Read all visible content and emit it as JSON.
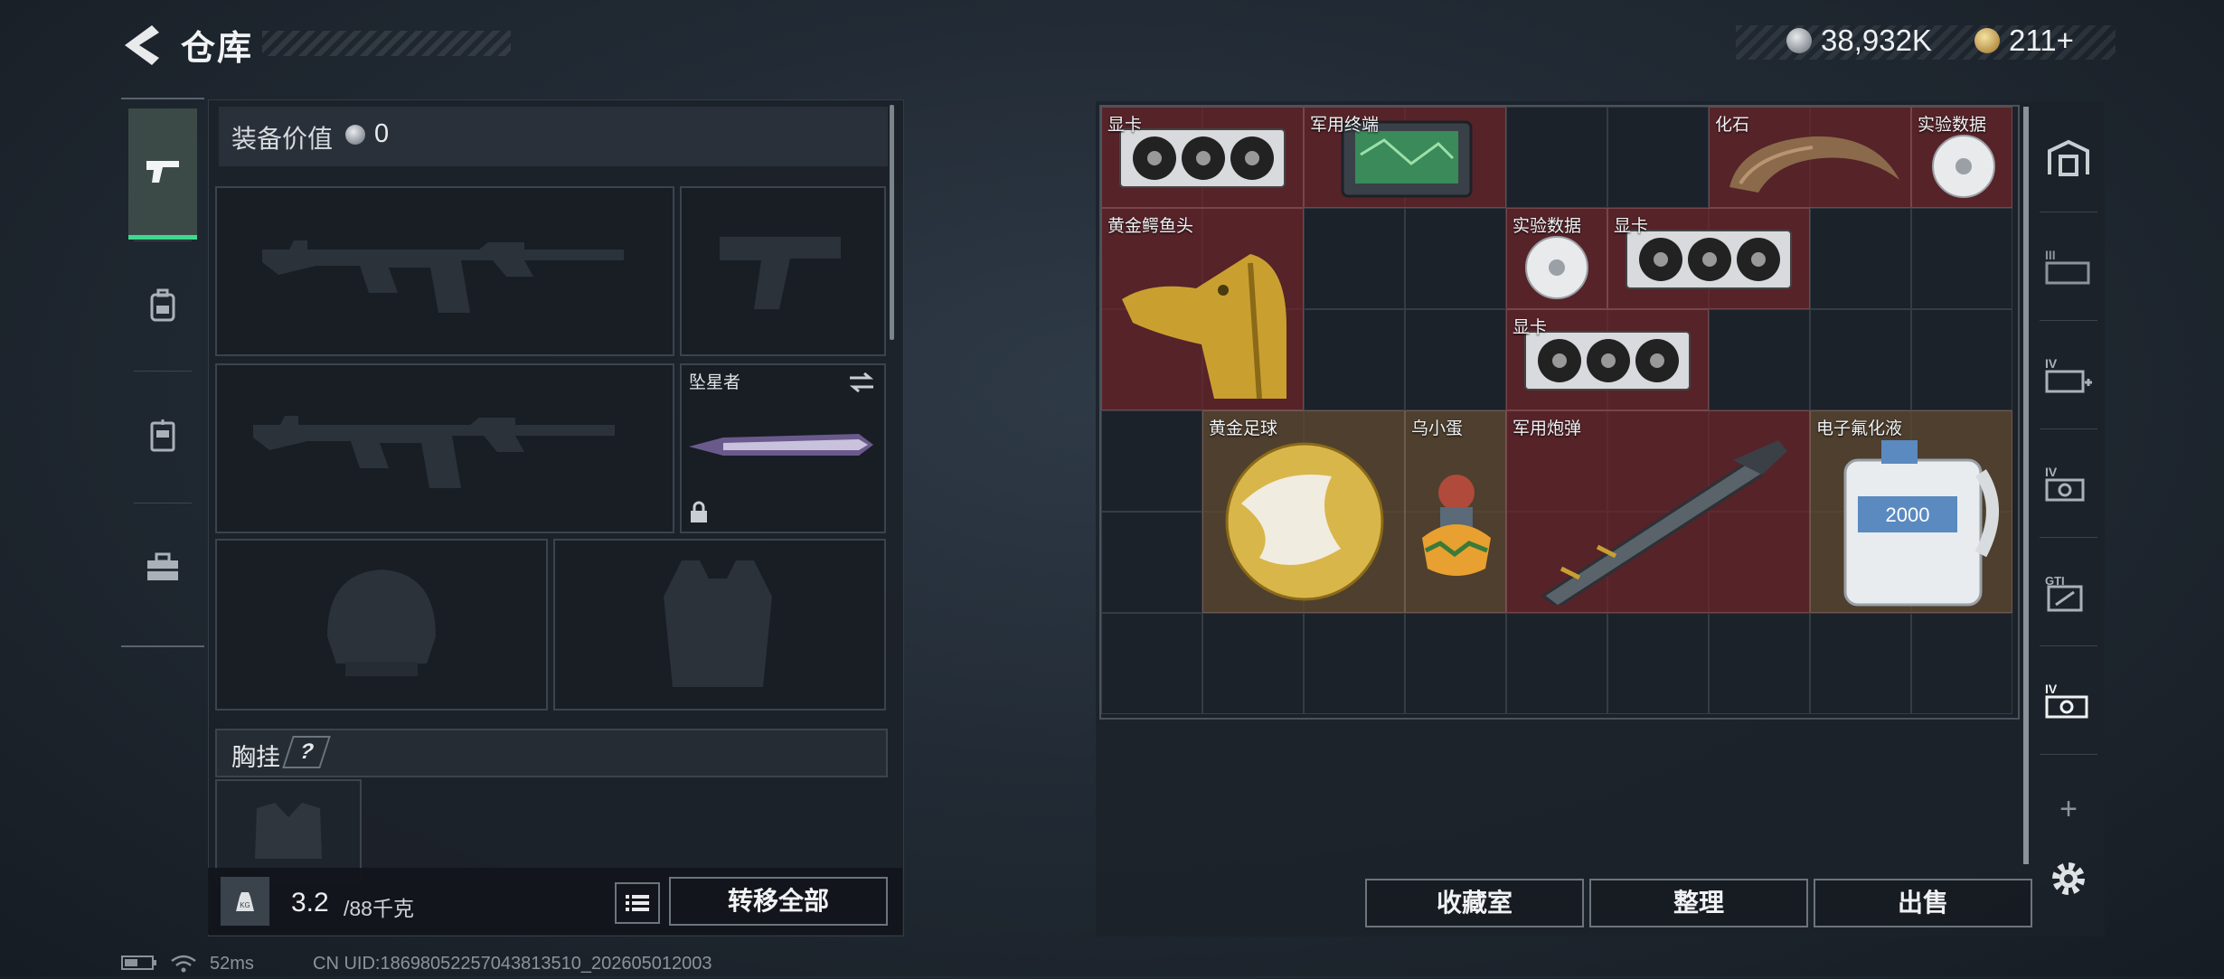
{
  "header": {
    "title": "仓库",
    "currency_silver": "38,932K",
    "currency_gold": "211+"
  },
  "left_panel": {
    "equip_value_label": "装备价值",
    "equip_value": "0",
    "melee_name": "坠星者",
    "chest_rig_label": "胸挂",
    "chest_rig_help": "?",
    "weight_current": "3.2",
    "weight_max": "/88千克",
    "transfer_all_label": "转移全部"
  },
  "inventory": {
    "items": [
      {
        "label": "显卡"
      },
      {
        "label": "军用终端"
      },
      {
        "label": "化石"
      },
      {
        "label": "实验数据"
      },
      {
        "label": "黄金鳄鱼头"
      },
      {
        "label": "实验数据"
      },
      {
        "label": "显卡"
      },
      {
        "label": "显卡"
      },
      {
        "label": "黄金足球"
      },
      {
        "label": "乌小蛋"
      },
      {
        "label": "军用炮弹"
      },
      {
        "label": "电子氟化液"
      }
    ],
    "collection_label": "收藏室",
    "sort_label": "整理",
    "sell_label": "出售"
  },
  "right_tabs": {
    "tab_labels": [
      "III",
      "IV",
      "IV",
      "GTI",
      "IV"
    ],
    "add_label": "+"
  },
  "status_bar": {
    "ping": "52ms",
    "uid": "CN UID:18698052257043813510_202605012003"
  },
  "colors": {
    "accent_green": "#3fd88f",
    "item_red": "#6e242a",
    "item_gold": "#5c4830"
  }
}
